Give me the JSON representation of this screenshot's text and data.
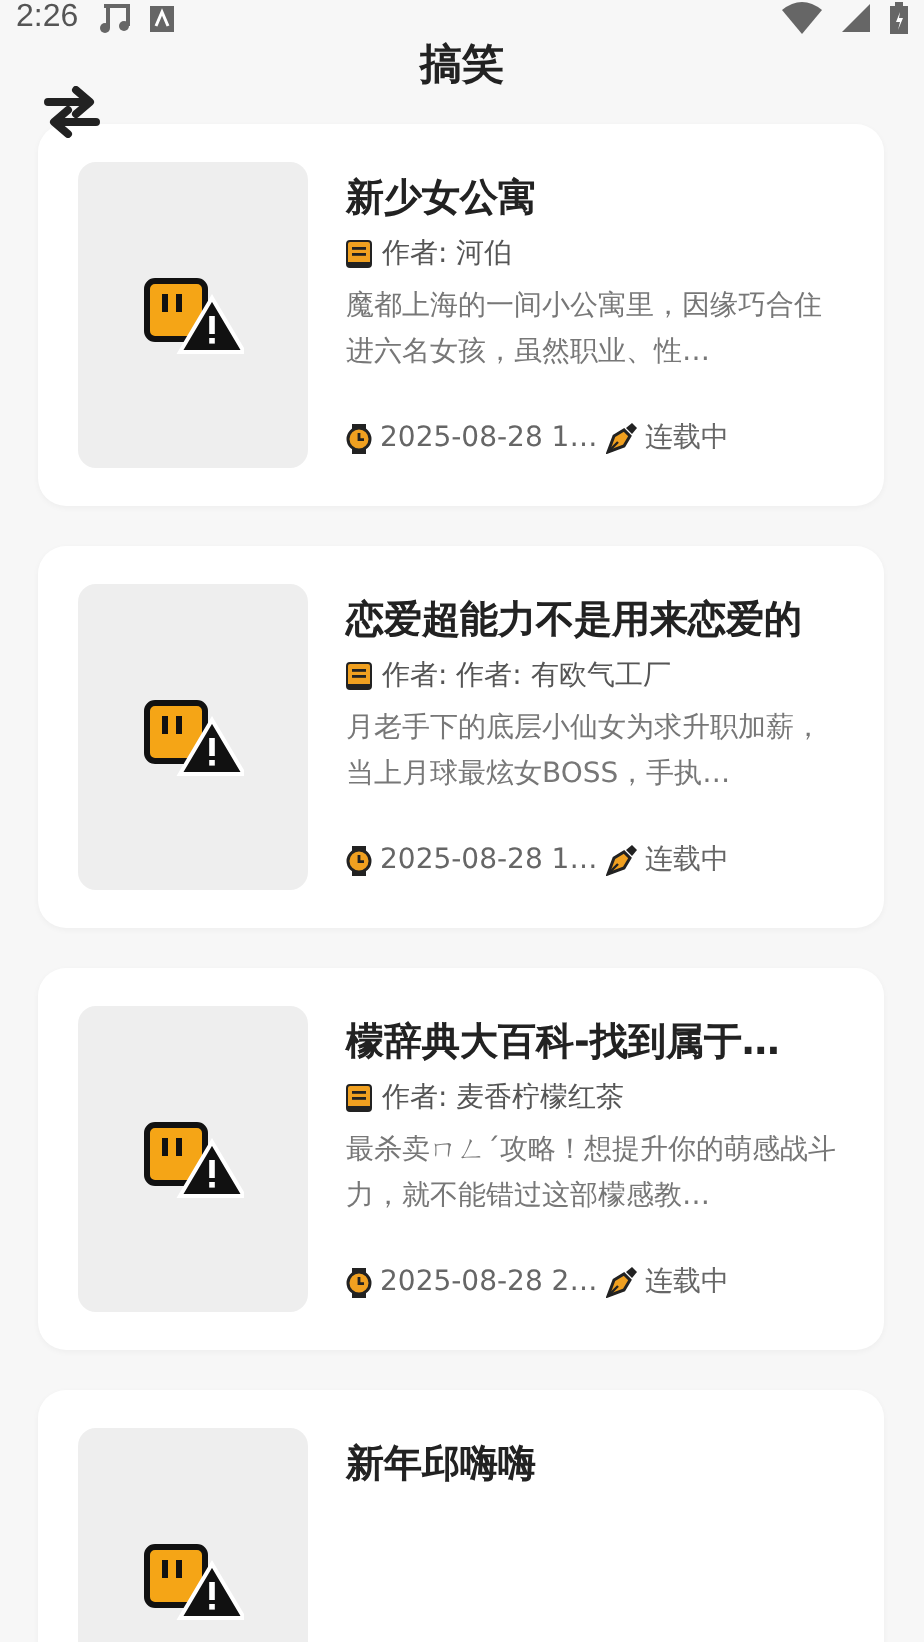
{
  "status_bar": {
    "time": "2:26"
  },
  "header": {
    "title": "搞笑"
  },
  "books": [
    {
      "title": "新少女公寓",
      "author": "作者: 河伯",
      "description": "魔都上海的一间小公寓里，因缘巧合住进六名女孩，虽然职业、性…",
      "updated": "2025-08-28 1…",
      "status": "连载中"
    },
    {
      "title": "恋爱超能力不是用来恋爱的",
      "author": "作者: 作者: 有欧气工厂",
      "description": "月老手下的底层小仙女为求升职加薪，当上月球最炫女BOSS，手执…",
      "updated": "2025-08-28 1…",
      "status": "连载中"
    },
    {
      "title": "檬辞典大百科-找到属于…",
      "author": "作者: 麦香柠檬红茶",
      "description": "最杀卖ㄇㄥˊ攻略！想提升你的萌感战斗力，就不能错过这部檬感教…",
      "updated": "2025-08-28 2…",
      "status": "连载中"
    },
    {
      "title": "新年邱嗨嗨"
    }
  ]
}
